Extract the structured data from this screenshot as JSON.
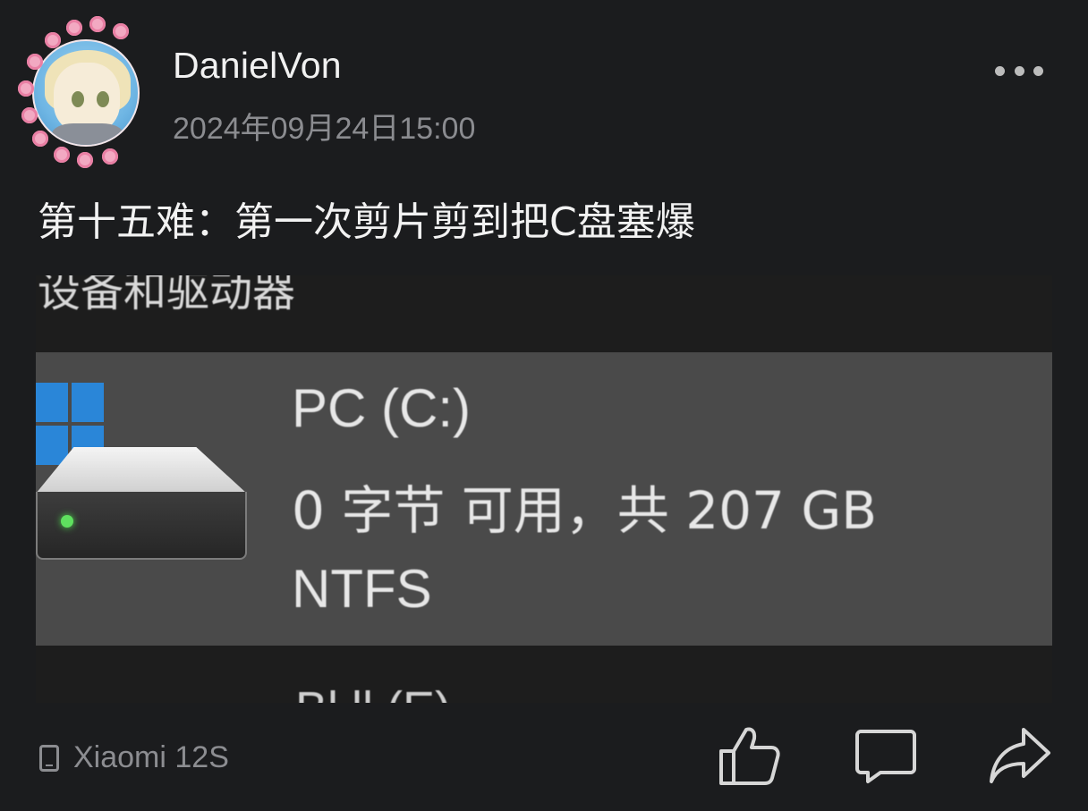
{
  "post": {
    "author": "DanielVon",
    "timestamp": "2024年09月24日15:00",
    "text": "第十五难：第一次剪片剪到把C盘塞爆",
    "device": "Xiaomi 12S"
  },
  "image": {
    "top_label": "设备和驱动器",
    "drive_name": "PC (C:)",
    "drive_space": "0 字节 可用，共 207 GB",
    "file_system": "NTFS",
    "next_item_partial": "Bl         ll     (E)"
  },
  "icons": {
    "more": "more-dots-icon",
    "device": "phone-icon",
    "like": "thumbs-up-icon",
    "comment": "comment-icon",
    "share": "share-icon"
  },
  "colors": {
    "background": "#1b1c1e",
    "text": "#f1f1f1",
    "muted": "#8b8c90",
    "windows_blue": "#2a86d8",
    "led_green": "#5fe05f"
  }
}
